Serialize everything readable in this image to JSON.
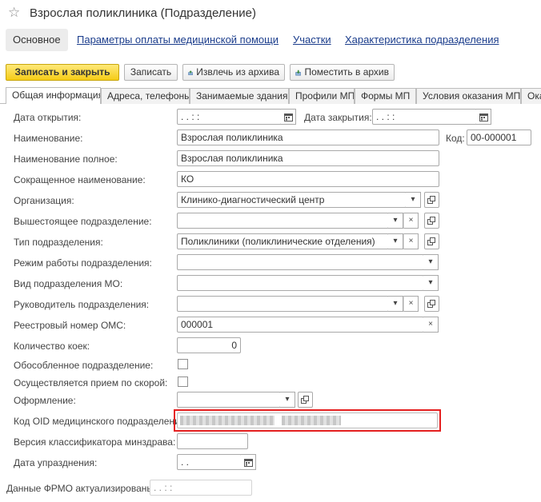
{
  "window": {
    "title": "Взрослая поликлиника (Подразделение)"
  },
  "nav": {
    "active": "Основное",
    "links": [
      "Параметры оплаты медицинской помощи",
      "Участки",
      "Характеристика подразделения"
    ]
  },
  "toolbar": {
    "save_close": "Записать и закрыть",
    "save": "Записать",
    "unarchive": "Извлечь из архива",
    "archive": "Поместить в архив"
  },
  "tabs": [
    "Общая информация",
    "Адреса, телефоны",
    "Занимаемые здания",
    "Профили МП",
    "Формы МП",
    "Условия оказания МП",
    "Ока"
  ],
  "form": {
    "open_date": {
      "label": "Дата открытия:",
      "value": " .  .       :  :"
    },
    "close_date": {
      "label": "Дата закрытия:",
      "value": " .  .       :  :"
    },
    "name": {
      "label": "Наименование:",
      "value": "Взрослая поликлиника"
    },
    "code": {
      "label": "Код:",
      "value": "00-000001"
    },
    "full_name": {
      "label": "Наименование полное:",
      "value": "Взрослая поликлиника"
    },
    "short_name": {
      "label": "Сокращенное наименование:",
      "value": "КО"
    },
    "organization": {
      "label": "Организация:",
      "value": "Клинико-диагностический центр"
    },
    "parent": {
      "label": "Вышестоящее подразделение:",
      "value": ""
    },
    "type": {
      "label": "Тип подразделения:",
      "value": "Поликлиники (поликлинические отделения)"
    },
    "work_mode": {
      "label": "Режим работы подразделения:",
      "value": ""
    },
    "mo_kind": {
      "label": "Вид подразделения МО:",
      "value": ""
    },
    "head": {
      "label": "Руководитель подразделения:",
      "value": ""
    },
    "oms_number": {
      "label": "Реестровый номер ОМС:",
      "value": "000001"
    },
    "beds": {
      "label": "Количество коек:",
      "value": "0"
    },
    "separate": {
      "label": "Обособленное подразделение:",
      "checked": false
    },
    "ambulance": {
      "label": "Осуществляется прием по скорой:",
      "checked": false
    },
    "registration": {
      "label": "Оформление:",
      "value": ""
    },
    "oid": {
      "label": "Код OID медицинского подразделения:",
      "value": ""
    },
    "classifier_version": {
      "label": "Версия классификатора минздрава:",
      "value": ""
    },
    "abolish_date": {
      "label": "Дата упразднения:",
      "value": " .  ."
    }
  },
  "footer": {
    "label": "Данные ФРМО актуализированы:",
    "value": " .  .       :  :"
  },
  "icons": {
    "star": "star-icon",
    "calendar": "calendar-icon",
    "dropdown": "chevron-down-icon",
    "clear": "clear-icon",
    "open": "open-icon"
  },
  "colors": {
    "accent_yellow": "#f5cc16",
    "link": "#1b3d8c",
    "highlight": "#e52020"
  }
}
